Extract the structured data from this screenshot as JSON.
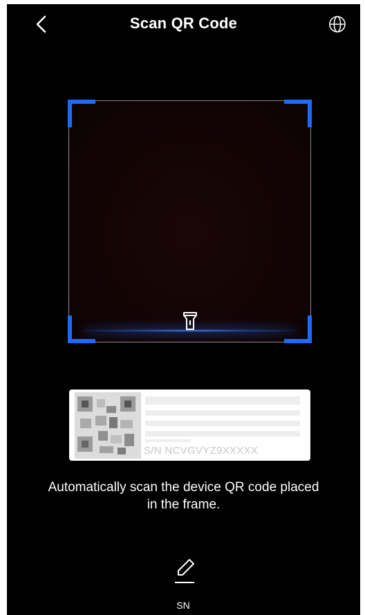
{
  "header": {
    "title": "Scan QR Code",
    "back_icon": "chevron-left-icon",
    "language_icon": "globe-icon"
  },
  "scanner": {
    "flashlight_icon": "flashlight-icon",
    "corner_color": "#1e6bff",
    "scan_line_color": "#3c82ff"
  },
  "label_sample": {
    "serial_text": "S/N  NCVGVYZ9XXXXX"
  },
  "hint": {
    "text": "Automatically scan the device QR code placed in the frame."
  },
  "manual_entry": {
    "icon": "edit-pencil-icon",
    "label": "SN"
  }
}
